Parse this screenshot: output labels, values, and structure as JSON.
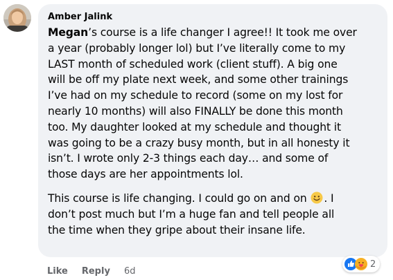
{
  "comment": {
    "author": "Amber Jalink",
    "mention": "Megan",
    "paragraph1_lines": [
      "’s course is a life changer I agree!! It took me over",
      "a year (probably longer lol) but I’ve literally come to my",
      "LAST month of scheduled work (client stuff). A big one",
      "will be off my plate next week, and some other trainings",
      "I’ve had on my schedule to record (some on my lost for",
      "nearly 10 months) will also FINALLY be done this month",
      "too. My daughter looked at my schedule and thought it",
      "was going to be a crazy busy month, but in all honesty it",
      "isn’t. I wrote only 2-3 things each day… and some of",
      "those days are her appointments lol."
    ],
    "paragraph2_line1_before_emoji": "This course is life changing. I could go on and on ",
    "paragraph2_line1_after_emoji": ". I",
    "paragraph2_lines": [
      "don’t post much but I’m a huge fan and tell people all",
      "the time when they gripe about their insane life."
    ],
    "emoji": "slightly-smiling-face",
    "reaction_icons": [
      "like-icon",
      "care-icon"
    ],
    "reaction_count": "2"
  },
  "actions": {
    "like_label": "Like",
    "reply_label": "Reply",
    "timestamp": "6d"
  },
  "colors": {
    "bubble": "#f0f2f5",
    "text": "#050505",
    "secondary": "#65676b",
    "like_blue": "#1877f2",
    "care_yellow": "#f7b125"
  }
}
